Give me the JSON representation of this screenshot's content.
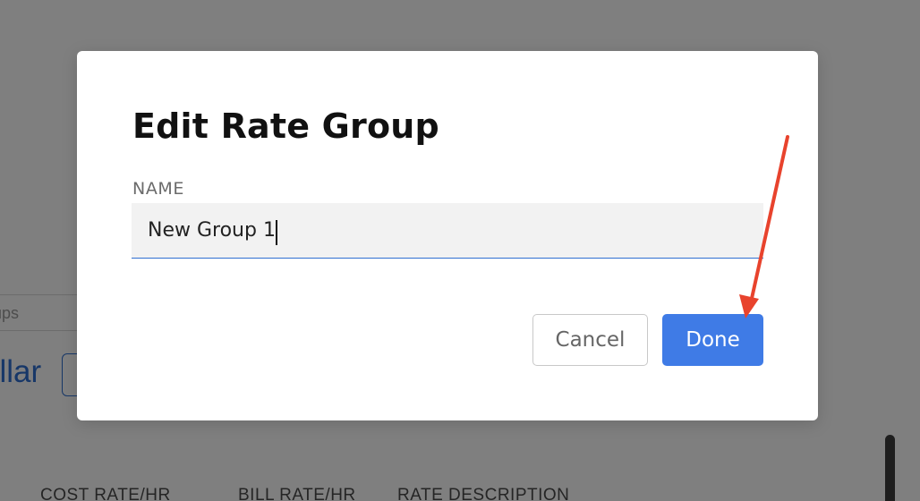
{
  "background": {
    "search_partial": "oups",
    "currency_partial": "ollar",
    "columns": [
      "COST RATE/HR",
      "BILL RATE/HR",
      "RATE DESCRIPTION"
    ]
  },
  "modal": {
    "title": "Edit Rate Group",
    "name_label": "NAME",
    "name_value": "New Group 1",
    "cancel_label": "Cancel",
    "done_label": "Done"
  },
  "colors": {
    "accent": "#3f7be6",
    "overlay": "rgba(0,0,0,0.5)",
    "annotation_arrow": "#e8432d"
  }
}
